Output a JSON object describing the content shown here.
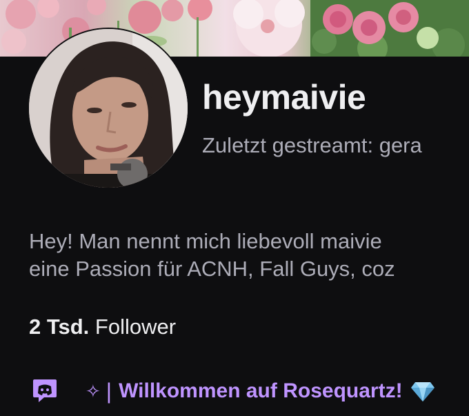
{
  "profile": {
    "username": "heymaivie",
    "last_streamed": "Zuletzt gestreamt: gera",
    "bio_lines": [
      "Hey! Man nennt mich liebevoll maivie",
      "eine Passion für ACNH, Fall Guys, coz"
    ],
    "followers_count": "2 Tsd.",
    "followers_label": "Follower"
  },
  "social": {
    "sparkle": "✧",
    "divider": "|",
    "discord_label": "Willkommen auf Rosequartz!",
    "icon": "discord-icon",
    "gem_icon": "gem-icon"
  },
  "colors": {
    "background": "#0e0e10",
    "text_primary": "#efeff1",
    "text_secondary": "#adadb8",
    "accent": "#bf94ff"
  }
}
